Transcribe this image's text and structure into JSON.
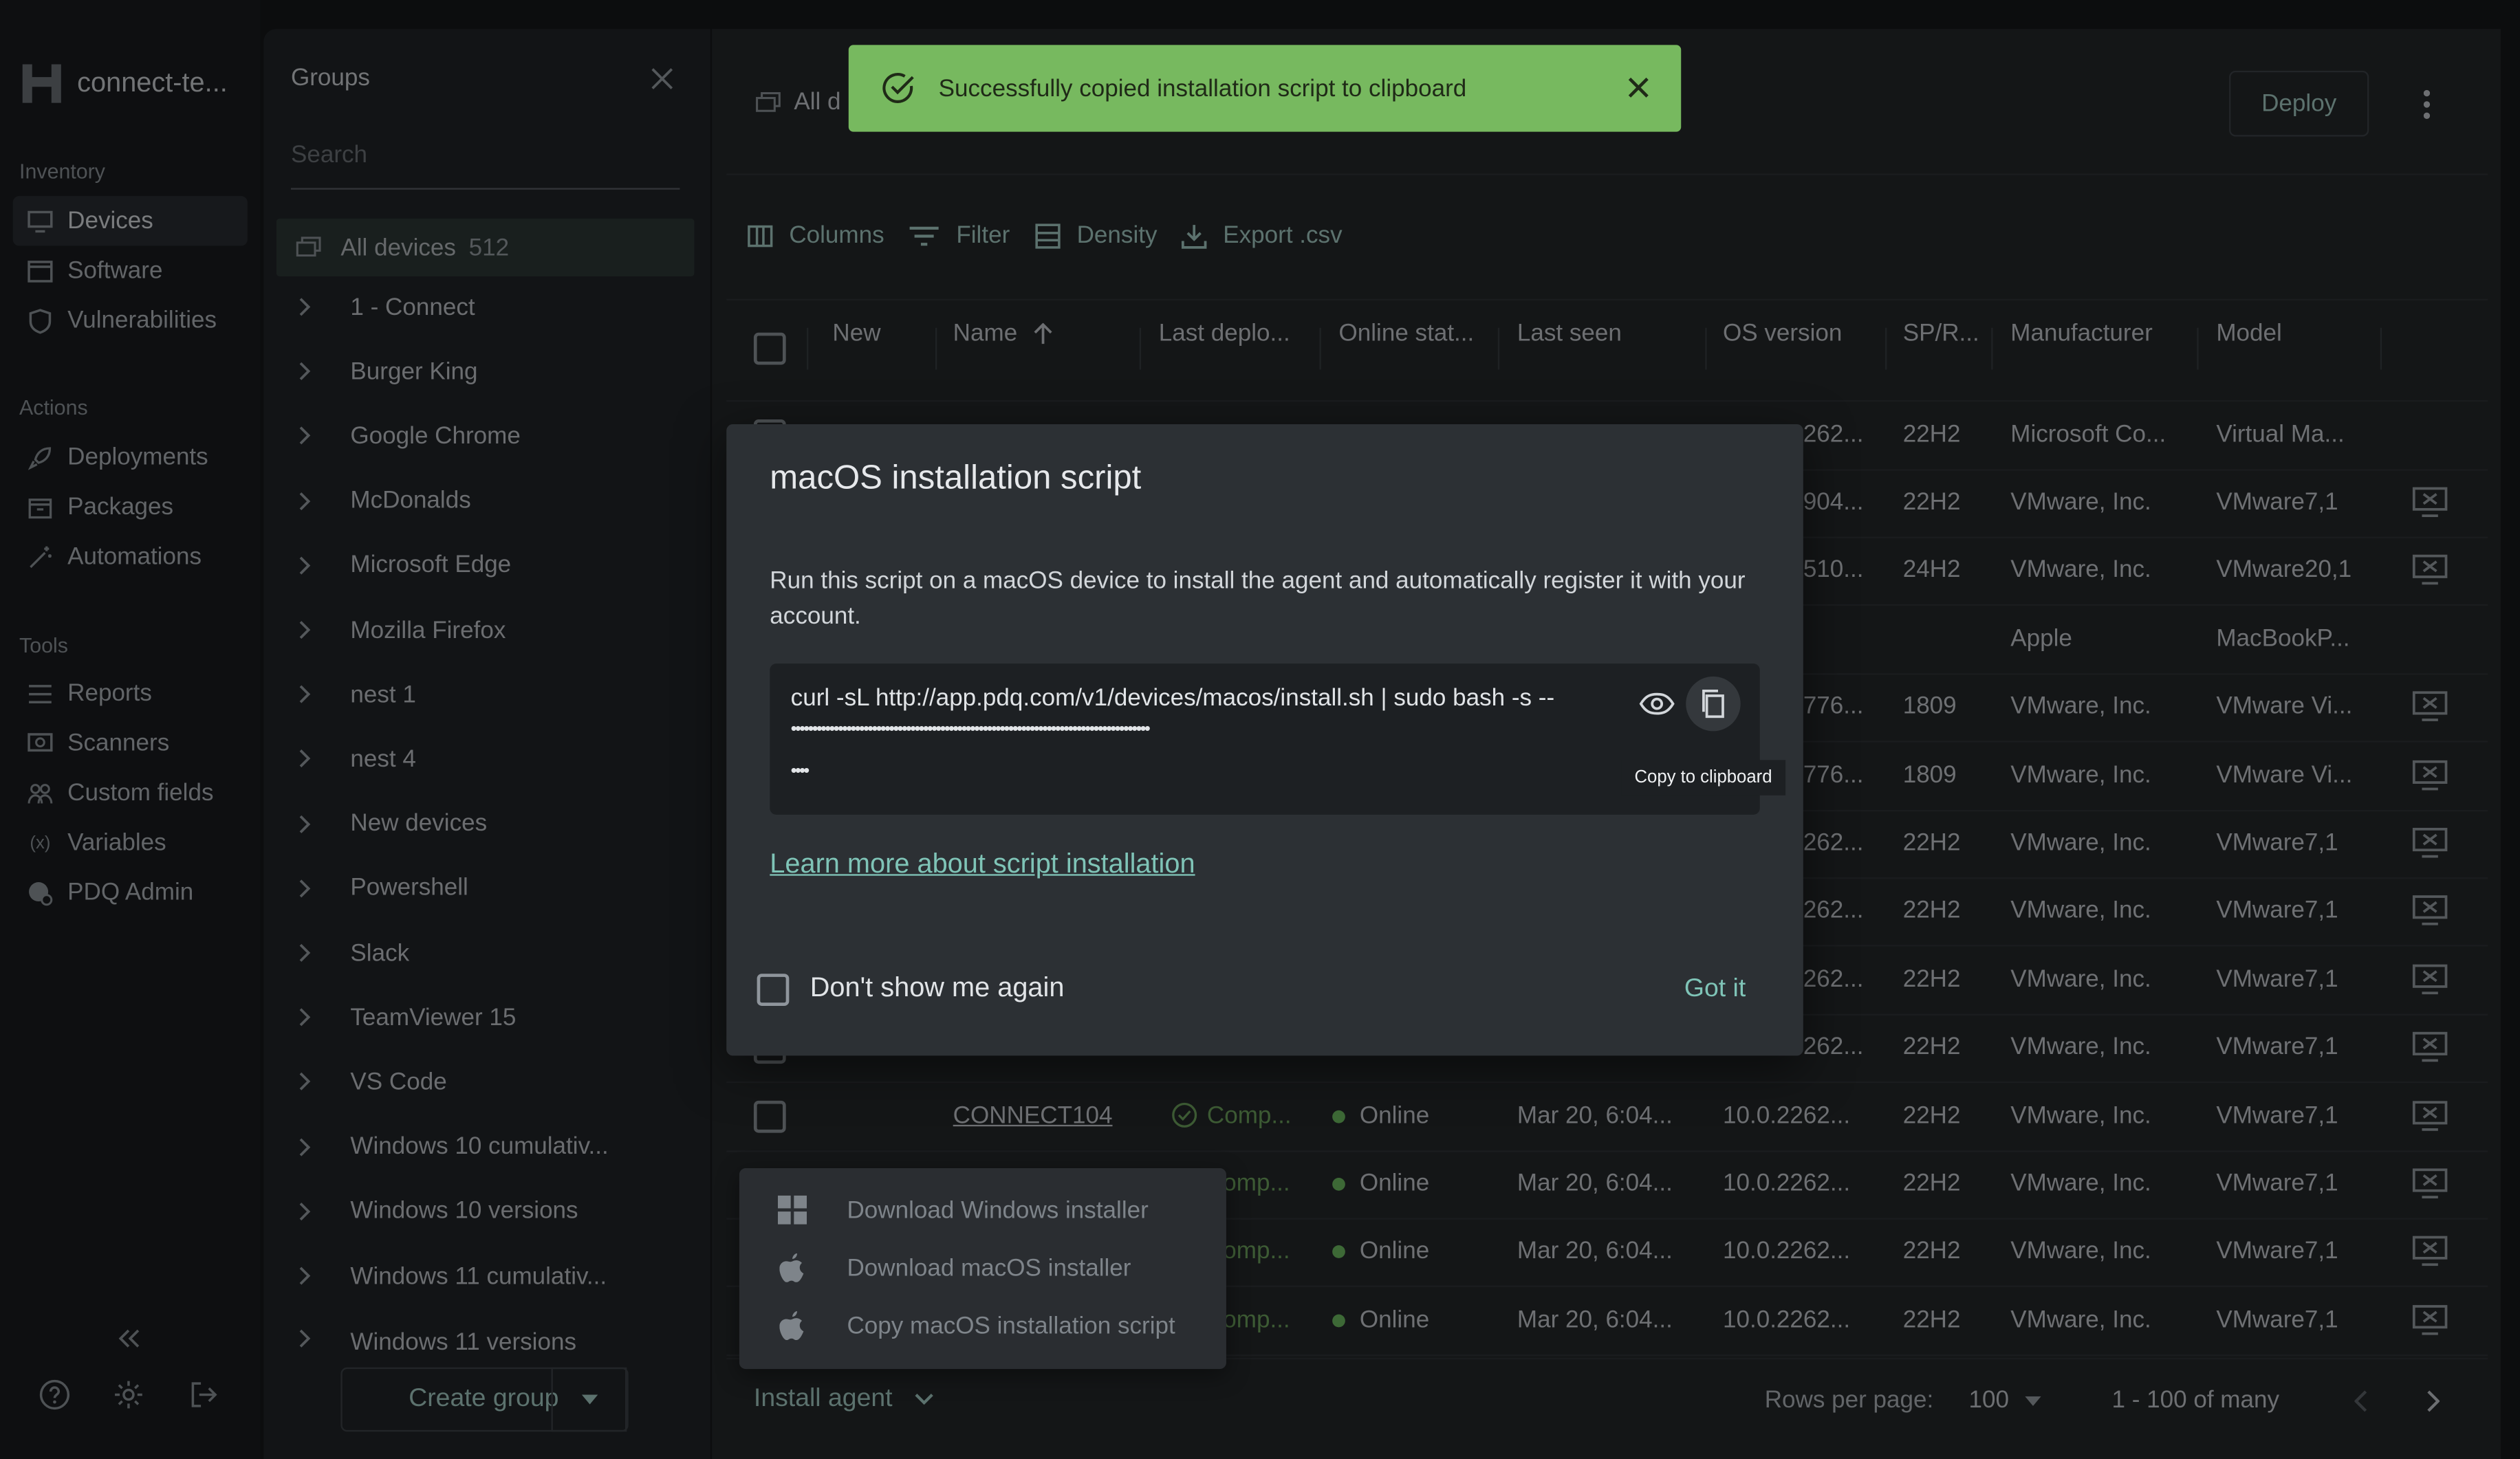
{
  "app": {
    "org_name": "connect-te..."
  },
  "nav": {
    "inventory_label": "Inventory",
    "devices": "Devices",
    "software": "Software",
    "vulnerabilities": "Vulnerabilities",
    "actions_label": "Actions",
    "deployments": "Deployments",
    "packages": "Packages",
    "automations": "Automations",
    "tools_label": "Tools",
    "reports": "Reports",
    "scanners": "Scanners",
    "custom_fields": "Custom fields",
    "variables": "Variables",
    "pdq_admin": "PDQ Admin"
  },
  "groups": {
    "title": "Groups",
    "search_placeholder": "Search",
    "all_devices_label": "All devices",
    "all_devices_count": "512",
    "items": [
      "1 - Connect",
      "Burger King",
      "Google Chrome",
      "McDonalds",
      "Microsoft Edge",
      "Mozilla Firefox",
      "nest 1",
      "nest 4",
      "New devices",
      "Powershell",
      "Slack",
      "TeamViewer 15",
      "VS Code",
      "Windows 10 cumulativ...",
      "Windows 10 versions",
      "Windows 11 cumulativ...",
      "Windows 11 versions"
    ],
    "create_group": "Create group"
  },
  "main": {
    "title_fragment": "All d",
    "deploy": "Deploy",
    "toolbar": {
      "columns": "Columns",
      "filter": "Filter",
      "density": "Density",
      "export": "Export .csv"
    },
    "headers": {
      "new": "New",
      "name": "Name",
      "last_deploy": "Last deplo...",
      "online_status": "Online stat...",
      "last_seen": "Last seen",
      "os_version": "OS version",
      "sp": "SP/R...",
      "manufacturer": "Manufacturer",
      "model": "Model"
    },
    "rows": [
      {
        "os": "262...",
        "sp": "22H2",
        "manufacturer": "Microsoft Co...",
        "model": "Virtual Ma...",
        "monitor": false
      },
      {
        "os": "904...",
        "sp": "22H2",
        "manufacturer": "VMware, Inc.",
        "model": "VMware7,1",
        "monitor": true
      },
      {
        "os": "510...",
        "sp": "24H2",
        "manufacturer": "VMware, Inc.",
        "model": "VMware20,1",
        "monitor": true
      },
      {
        "os": "",
        "sp": "",
        "manufacturer": "Apple",
        "model": "MacBookP...",
        "monitor": false
      },
      {
        "os": "776...",
        "sp": "1809",
        "manufacturer": "VMware, Inc.",
        "model": "VMware Vi...",
        "monitor": true
      },
      {
        "os": "776...",
        "sp": "1809",
        "manufacturer": "VMware, Inc.",
        "model": "VMware Vi...",
        "monitor": true
      },
      {
        "os": "262...",
        "sp": "22H2",
        "manufacturer": "VMware, Inc.",
        "model": "VMware7,1",
        "monitor": true
      },
      {
        "os": "262...",
        "sp": "22H2",
        "manufacturer": "VMware, Inc.",
        "model": "VMware7,1",
        "monitor": true
      },
      {
        "os": "262...",
        "sp": "22H2",
        "manufacturer": "VMware, Inc.",
        "model": "VMware7,1",
        "monitor": true
      },
      {
        "os": "262...",
        "sp": "22H2",
        "manufacturer": "VMware, Inc.",
        "model": "VMware7,1",
        "monitor": true
      },
      {
        "name": "CONNECT104",
        "deploy": "Comp...",
        "online": "Online",
        "last_seen": "Mar 20, 6:04...",
        "os": "10.0.2262...",
        "sp": "22H2",
        "manufacturer": "VMware, Inc.",
        "model": "VMware7,1",
        "monitor": true
      },
      {
        "deploy": "omp...",
        "online": "Online",
        "last_seen": "Mar 20, 6:04...",
        "os": "10.0.2262...",
        "sp": "22H2",
        "manufacturer": "VMware, Inc.",
        "model": "VMware7,1",
        "monitor": true
      },
      {
        "deploy": "omp...",
        "online": "Online",
        "last_seen": "Mar 20, 6:04...",
        "os": "10.0.2262...",
        "sp": "22H2",
        "manufacturer": "VMware, Inc.",
        "model": "VMware7,1",
        "monitor": true
      },
      {
        "deploy": "omp...",
        "online": "Online",
        "last_seen": "Mar 20, 6:04...",
        "os": "10.0.2262...",
        "sp": "22H2",
        "manufacturer": "VMware, Inc.",
        "model": "VMware7,1",
        "monitor": true
      }
    ],
    "footer": {
      "install_agent": "Install agent",
      "rows_per_page_label": "Rows per page:",
      "rows_per_page": "100",
      "range": "1 - 100 of many"
    }
  },
  "install_menu": {
    "windows": "Download Windows installer",
    "macos": "Download macOS installer",
    "copy_script": "Copy macOS installation script"
  },
  "modal": {
    "title": "macOS installation script",
    "description": "Run this script on a macOS device to install the agent and automatically register it with your account.",
    "script_line": "curl -sL http://app.pdq.com/v1/devices/macos/install.sh | sudo bash -s --",
    "mask_line1": "••••••••••••••••••••••••••••••••••••••••••••••••••••••••••••••••••••••••••••••••••••",
    "mask_line2": "••••",
    "copy_tooltip": "Copy to clipboard",
    "learn_more": "Learn more about script installation",
    "dont_show": "Don't show me again",
    "got_it": "Got it"
  },
  "toast": {
    "message": "Successfully copied installation script to clipboard"
  },
  "colors": {
    "accent": "#7fc4b7",
    "toast_bg": "#77b95f",
    "online_dot": "#6fbf63"
  }
}
